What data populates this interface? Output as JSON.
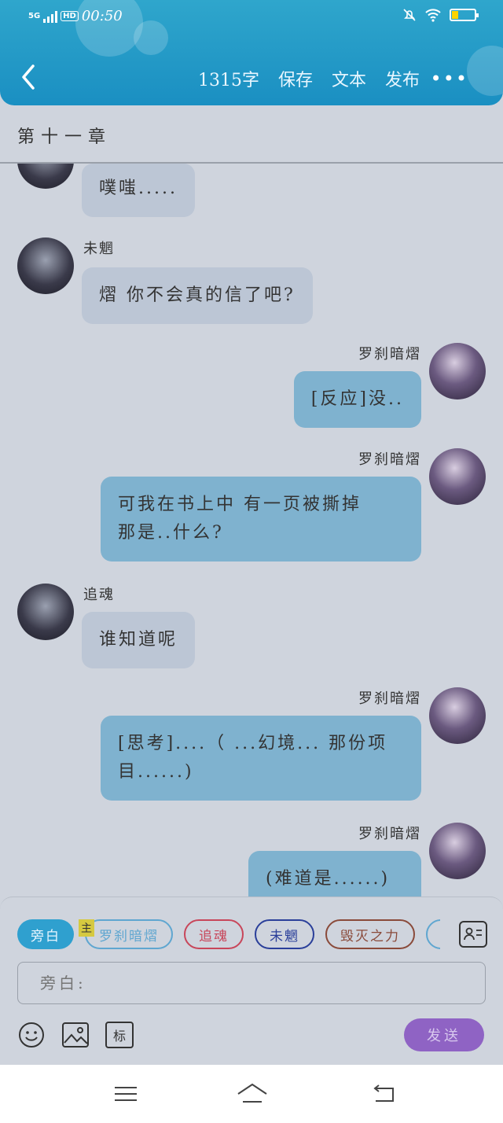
{
  "status": {
    "network": "5G",
    "hd": "HD",
    "time": "00:50"
  },
  "header": {
    "word_count": "1315字",
    "save_label": "保存",
    "text_label": "文本",
    "publish_label": "发布",
    "more_label": "•••"
  },
  "chapter": {
    "title": "第十一章"
  },
  "messages": [
    {
      "side": "left",
      "name": "",
      "text": "噗嗤....."
    },
    {
      "side": "left",
      "name": "未魍",
      "text": "熠 你不会真的信了吧?"
    },
    {
      "side": "right",
      "name": "罗刹暗熠",
      "text": "[反应]没.."
    },
    {
      "side": "right",
      "name": "罗刹暗熠",
      "text": "可我在书上中  有一页被撕掉",
      "text2": "那是..什么?"
    },
    {
      "side": "left",
      "name": "追魂",
      "text": "谁知道呢"
    },
    {
      "side": "right",
      "name": "罗刹暗熠",
      "text": "[思考]....（ ...幻境... 那份项",
      "text2": "目......)"
    },
    {
      "side": "right",
      "name": "罗刹暗熠",
      "text": "(难道是......)"
    }
  ],
  "roles": [
    {
      "label": "旁白",
      "active": true
    },
    {
      "label": "罗刹暗熠",
      "badge": "主"
    },
    {
      "label": "追魂"
    },
    {
      "label": "未魍"
    },
    {
      "label": "毁灭之力"
    }
  ],
  "colors": {
    "header": "#1a8fc2",
    "send": "#8f63c4",
    "role_luosha": "#5fa6d0",
    "role_zhuihun": "#c8465a",
    "role_weiwang": "#2a3f9a",
    "role_huimie": "#8a4a3a"
  },
  "input": {
    "placeholder": "旁白:"
  },
  "composer": {
    "send_label": "发送",
    "mark_label": "标"
  }
}
